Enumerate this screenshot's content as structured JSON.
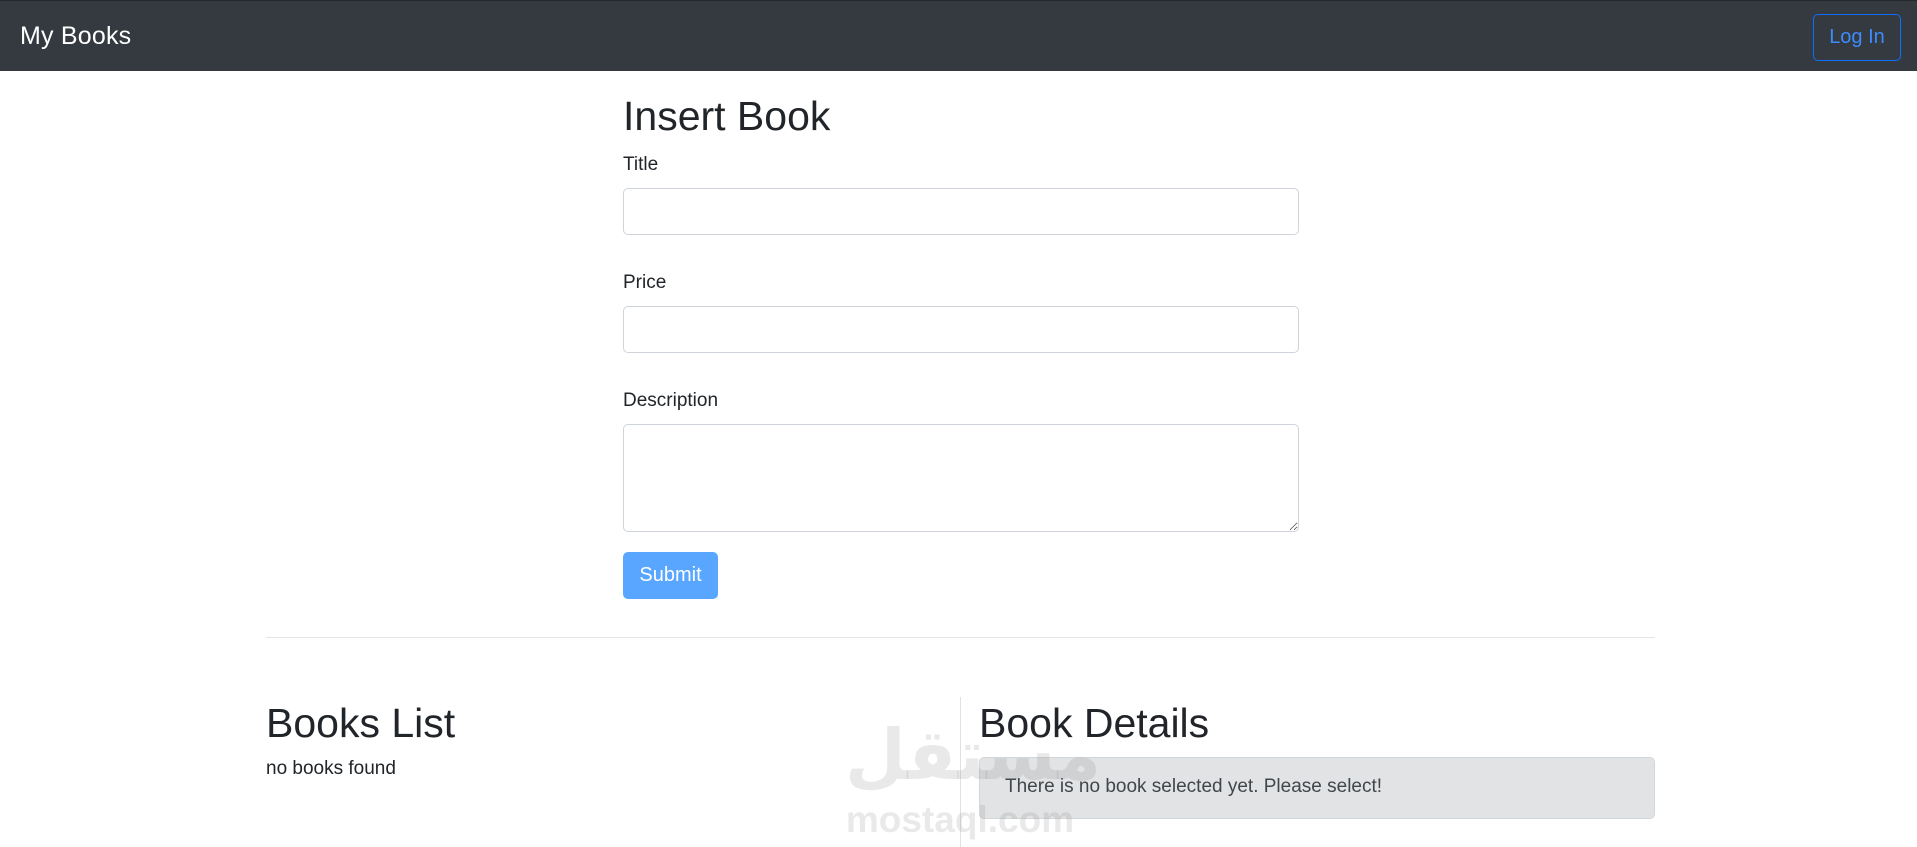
{
  "navbar": {
    "brand": "My Books",
    "login_label": "Log In"
  },
  "form": {
    "title": "Insert Book",
    "fields": [
      {
        "label": "Title",
        "value": ""
      },
      {
        "label": "Price",
        "value": ""
      },
      {
        "label": "Description",
        "value": ""
      }
    ],
    "submit_label": "Submit"
  },
  "books_list": {
    "title": "Books List",
    "empty_message": "no books found"
  },
  "book_details": {
    "title": "Book Details",
    "empty_message": "There is no book selected yet. Please select!"
  },
  "watermark": {
    "arabic": "مستقل",
    "latin": "mostaql.com"
  },
  "colors": {
    "navbar_bg": "#343a40",
    "accent": "#0d6efd",
    "submit_bg": "#58a6ff",
    "alert_bg": "#e2e3e5"
  }
}
